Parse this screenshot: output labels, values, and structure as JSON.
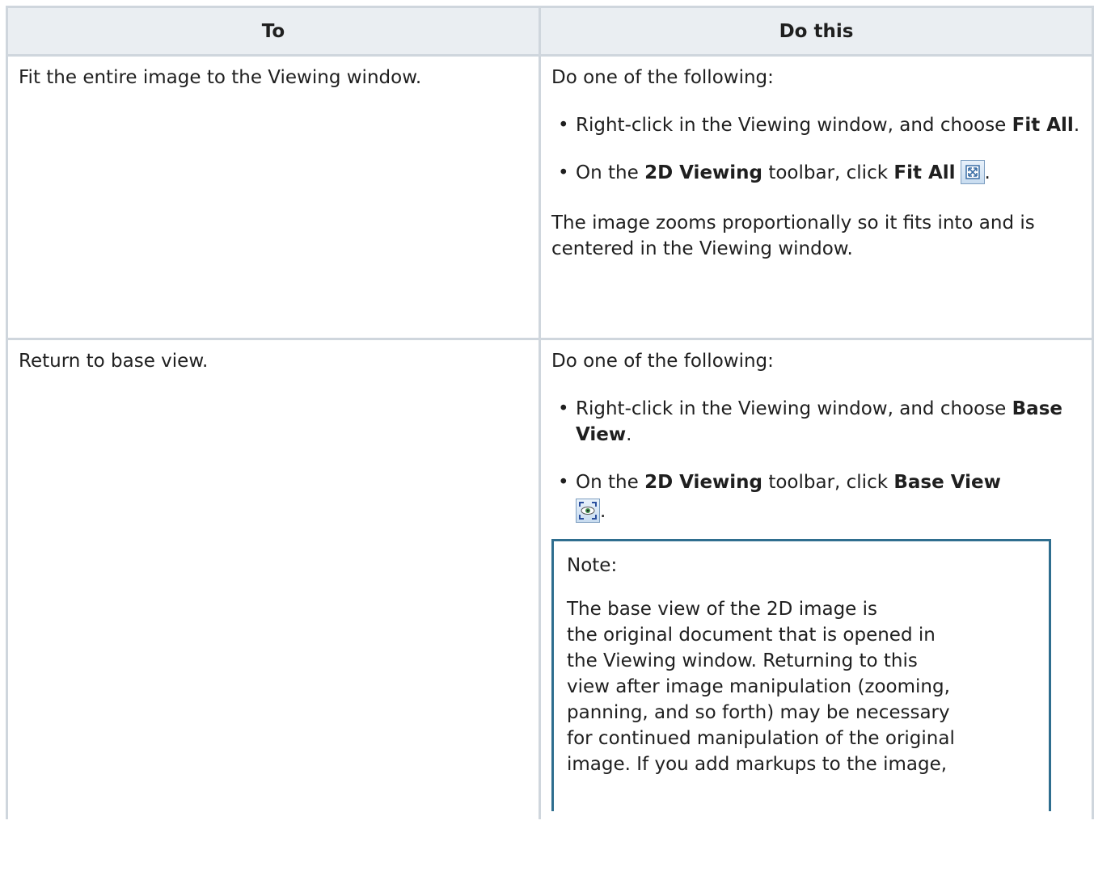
{
  "table": {
    "headers": {
      "to": "To",
      "do_this": "Do this"
    },
    "row1": {
      "to": "Fit the entire image to the Viewing window.",
      "intro": "Do one of the following:",
      "bullet1": {
        "pre": "Right-click in the Viewing window, and choose ",
        "bold": "Fit All",
        "post": "."
      },
      "bullet2": {
        "pre": "On the ",
        "bold1": "2D Viewing",
        "mid": " toolbar, click ",
        "bold2": "Fit All",
        "icon": "fit-all-icon",
        "post": "."
      },
      "result": "The image zooms proportionally so it fits into and is centered in the Viewing window."
    },
    "row2": {
      "to": "Return to base view.",
      "intro": "Do one of the following:",
      "bullet1": {
        "pre": "Right-click in the Viewing window, and choose ",
        "bold": "Base View",
        "post": "."
      },
      "bullet2": {
        "pre": "On the ",
        "bold1": "2D Viewing",
        "mid": " toolbar, click ",
        "bold2": "Base View",
        "icon": "base-view-icon",
        "post": "."
      },
      "note": {
        "title": "Note:",
        "lines": [
          "The base view of the 2D image is",
          "the original document that is opened in",
          "the Viewing window. Returning to this",
          "view after image manipulation (zooming,",
          "panning, and so forth) may be necessary",
          "for continued manipulation of the original",
          "image. If you add markups to the image,"
        ]
      }
    }
  },
  "colors": {
    "header_bg": "#eaeef2",
    "border": "#cfd6dd",
    "note_border": "#2f6e8f",
    "text": "#1f1f1f"
  }
}
